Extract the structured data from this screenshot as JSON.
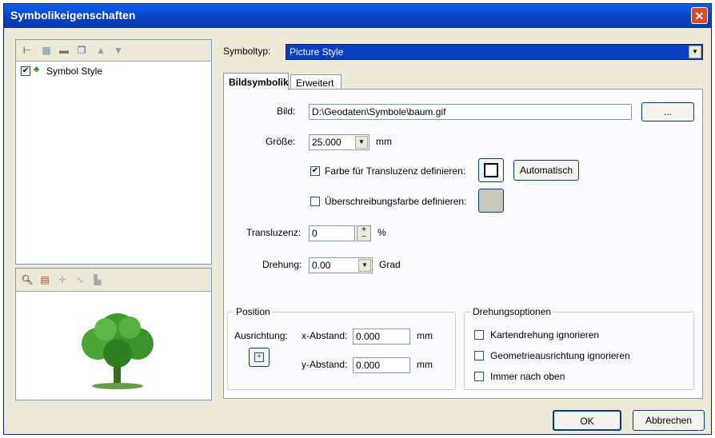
{
  "window": {
    "title": "Symbolikeigenschaften",
    "close_symbol": "✕"
  },
  "left_toolbar": {
    "icons": [
      "tree-icon",
      "layer-icon",
      "delete-icon",
      "copy-icon",
      "move-up-icon",
      "move-down-icon"
    ]
  },
  "tree": {
    "items": [
      {
        "label": "Symbol Style",
        "checked": true
      }
    ]
  },
  "preview_toolbar": {
    "icons": [
      "zoom-icon",
      "grid-icon",
      "crosshair-icon",
      "wave-icon",
      "bar-icon"
    ]
  },
  "symboltyp": {
    "label": "Symboltyp:",
    "value": "Picture Style"
  },
  "tabs": [
    {
      "label": "Bildsymbolik"
    },
    {
      "label": "Erweitert"
    }
  ],
  "bild": {
    "label": "Bild:",
    "value": "D:\\Geodaten\\Symbole\\baum.gif",
    "browse_label": "..."
  },
  "groesse": {
    "label": "Größe:",
    "value": "25.000",
    "unit": "mm"
  },
  "transluzenz_farbe": {
    "label": "Farbe für Transluzenz definieren:",
    "checked": true,
    "auto_label": "Automatisch"
  },
  "ueberschreibung": {
    "label": "Überschreibungsfarbe definieren:",
    "checked": false
  },
  "transluzenz": {
    "label": "Transluzenz:",
    "value": "0",
    "unit": "%"
  },
  "drehung": {
    "label": "Drehung:",
    "value": "0.00",
    "unit": "Grad"
  },
  "position": {
    "title": "Position",
    "ausrichtung_label": "Ausrichtung:",
    "x_label": "x-Abstand:",
    "x_value": "0.000",
    "y_label": "y-Abstand:",
    "y_value": "0.000",
    "unit": "mm"
  },
  "drehungsoptionen": {
    "title": "Drehungsoptionen",
    "options": [
      {
        "label": "Kartendrehung ignorieren",
        "checked": false
      },
      {
        "label": "Geometrieausrichtung ignorieren",
        "checked": false
      },
      {
        "label": "Immer nach oben",
        "checked": false
      }
    ]
  },
  "buttons": {
    "ok": "OK",
    "cancel": "Abbrechen"
  }
}
